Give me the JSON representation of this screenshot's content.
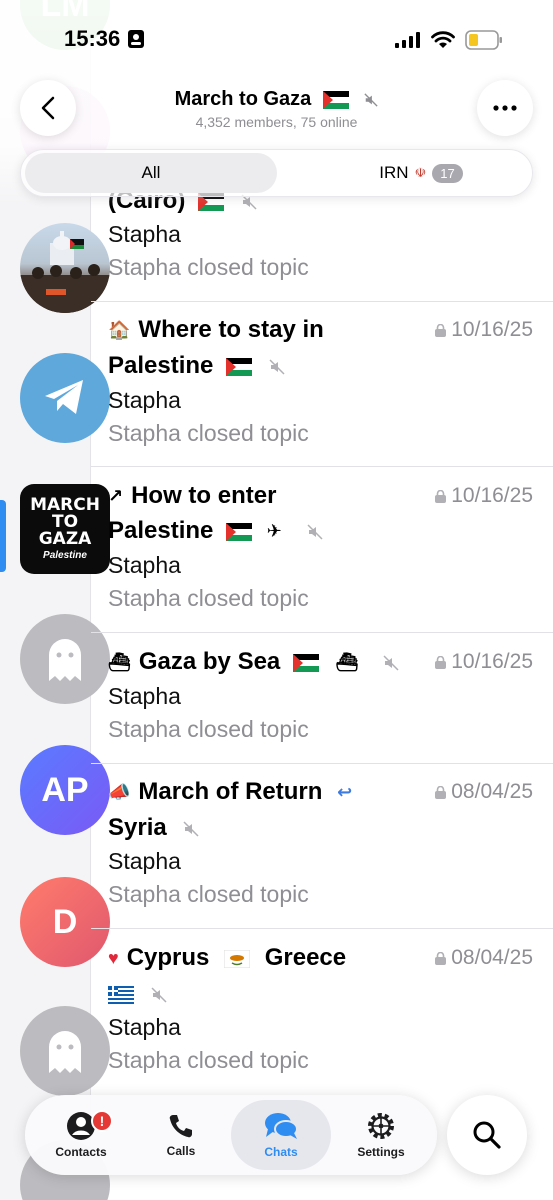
{
  "status_bar": {
    "time": "15:36"
  },
  "header": {
    "title": "March to Gaza",
    "subtitle": "4,352 members, 75 online"
  },
  "segments": {
    "all_label": "All",
    "irn_label": "IRN",
    "irn_count": "17"
  },
  "rail": {
    "avatars": [
      {
        "initials": "LM"
      },
      {
        "initials": ""
      },
      {
        "initials": ""
      },
      {
        "initials": ""
      },
      {
        "march_line1": "MARCH",
        "march_line2": "TO",
        "march_line3": "GAZA",
        "march_sub": "Palestine"
      },
      {
        "initials": ""
      },
      {
        "initials": "AP"
      },
      {
        "initials": "D"
      }
    ]
  },
  "topics": [
    {
      "title": "(Cairo)",
      "sender": "Stapha",
      "preview": "Stapha closed topic",
      "date": ""
    },
    {
      "icon": "house-emoji",
      "title_line1": "Where to stay in",
      "title_line2": "Palestine",
      "sender": "Stapha",
      "preview": "Stapha closed topic",
      "date": "10/16/25"
    },
    {
      "icon": "arrow-square-emoji",
      "title_line1": "How to enter",
      "title_line2": "Palestine",
      "sender": "Stapha",
      "preview": "Stapha closed topic",
      "date": "10/16/25"
    },
    {
      "icon": "ship-emoji",
      "title_line1": "Gaza by Sea",
      "sender": "Stapha",
      "preview": "Stapha closed topic",
      "date": "10/16/25"
    },
    {
      "icon": "megaphone-emoji",
      "title_line1": "March of Return",
      "title_line2": "Syria",
      "sender": "Stapha",
      "preview": "Stapha closed topic",
      "date": "08/04/25"
    },
    {
      "icon": "heart-emoji",
      "title_line1": "Cyprus",
      "title_mid": "Greece",
      "sender": "Stapha",
      "preview": "Stapha closed topic",
      "date": "08/04/25"
    }
  ],
  "tabbar": {
    "contacts": "Contacts",
    "contacts_badge": "!",
    "calls": "Calls",
    "chats": "Chats",
    "settings": "Settings"
  },
  "colors": {
    "accent": "#2f8cf0",
    "muted_text": "#8e8e93",
    "badge_red": "#e53935"
  }
}
